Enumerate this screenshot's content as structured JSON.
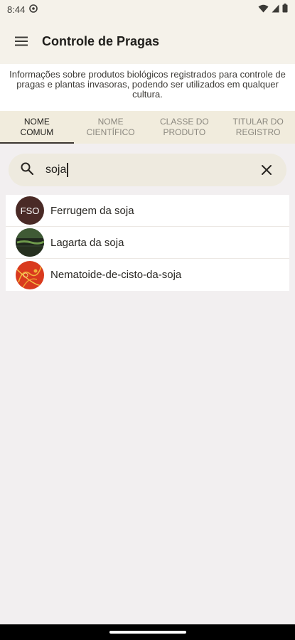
{
  "status_bar": {
    "time": "8:44"
  },
  "app_bar": {
    "title": "Controle de Pragas",
    "menu_icon": "hamburger-menu-icon"
  },
  "description": "Informações sobre produtos biológicos registrados para controle de pragas e plantas invasoras, podendo ser utilizados em qualquer cultura.",
  "tabs": [
    {
      "label_line1": "Nome",
      "label_line2": "comum",
      "active": true
    },
    {
      "label_line1": "Nome",
      "label_line2": "científico",
      "active": false
    },
    {
      "label_line1": "Classe do",
      "label_line2": "produto",
      "active": false
    },
    {
      "label_line1": "Titular do",
      "label_line2": "registro",
      "active": false
    }
  ],
  "search": {
    "value": "soja",
    "search_icon": "search-icon",
    "clear_icon": "close-icon"
  },
  "results": [
    {
      "label": "Ferrugem da soja",
      "thumb_text": "FSO"
    },
    {
      "label": "Lagarta da soja"
    },
    {
      "label": "Nematoide-de-cisto-da-soja"
    }
  ],
  "colors": {
    "accent": "#3b3630",
    "tab_background": "#f1ecdd",
    "app_bar": "#f5f2ea"
  }
}
